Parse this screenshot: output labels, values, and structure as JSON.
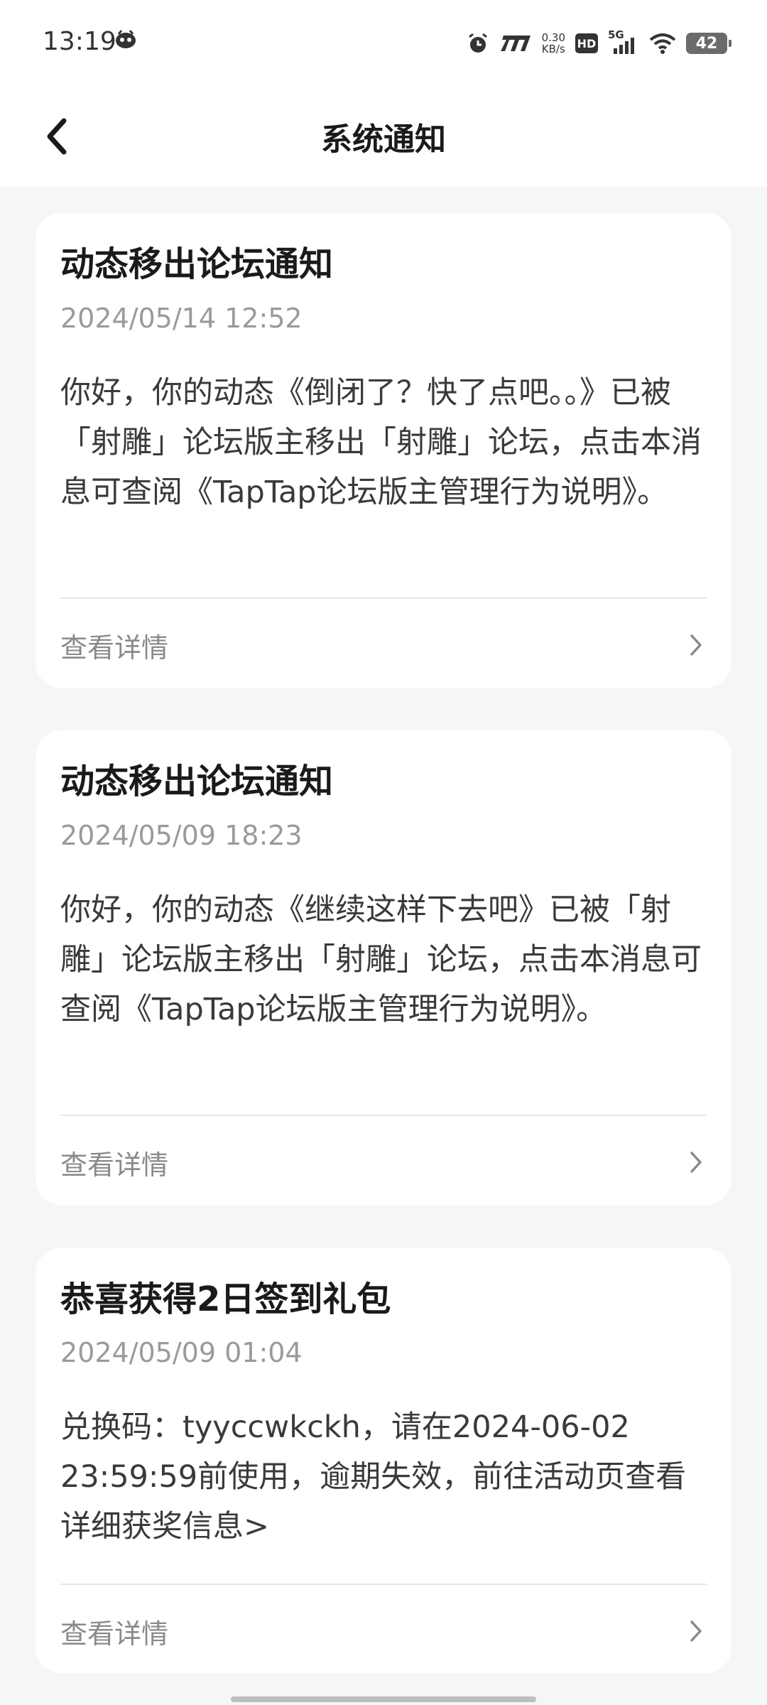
{
  "status_bar": {
    "time": "13:19",
    "speed_value": "0.30",
    "speed_unit": "KB/s",
    "hd": "HD",
    "network": "5G",
    "battery": "42"
  },
  "nav": {
    "title": "系统通知"
  },
  "notifications": [
    {
      "title": "动态移出论坛通知",
      "time": "2024/05/14 12:52",
      "body": "你好，你的动态《倒闭了？快了点吧。。》已被「射雕」论坛版主移出「射雕」论坛，点击本消息可查阅《TapTap论坛版主管理行为说明》。",
      "detail_label": "查看详情"
    },
    {
      "title": "动态移出论坛通知",
      "time": "2024/05/09 18:23",
      "body": "你好，你的动态《继续这样下去吧》已被「射雕」论坛版主移出「射雕」论坛，点击本消息可查阅《TapTap论坛版主管理行为说明》。",
      "detail_label": "查看详情"
    },
    {
      "title": "恭喜获得2日签到礼包",
      "time": "2024/05/09 01:04",
      "body": "兑换码：tyyccwkckh，请在2024-06-02 23:59:59前使用，逾期失效，前往活动页查看详细获奖信息>",
      "detail_label": "查看详情"
    }
  ]
}
